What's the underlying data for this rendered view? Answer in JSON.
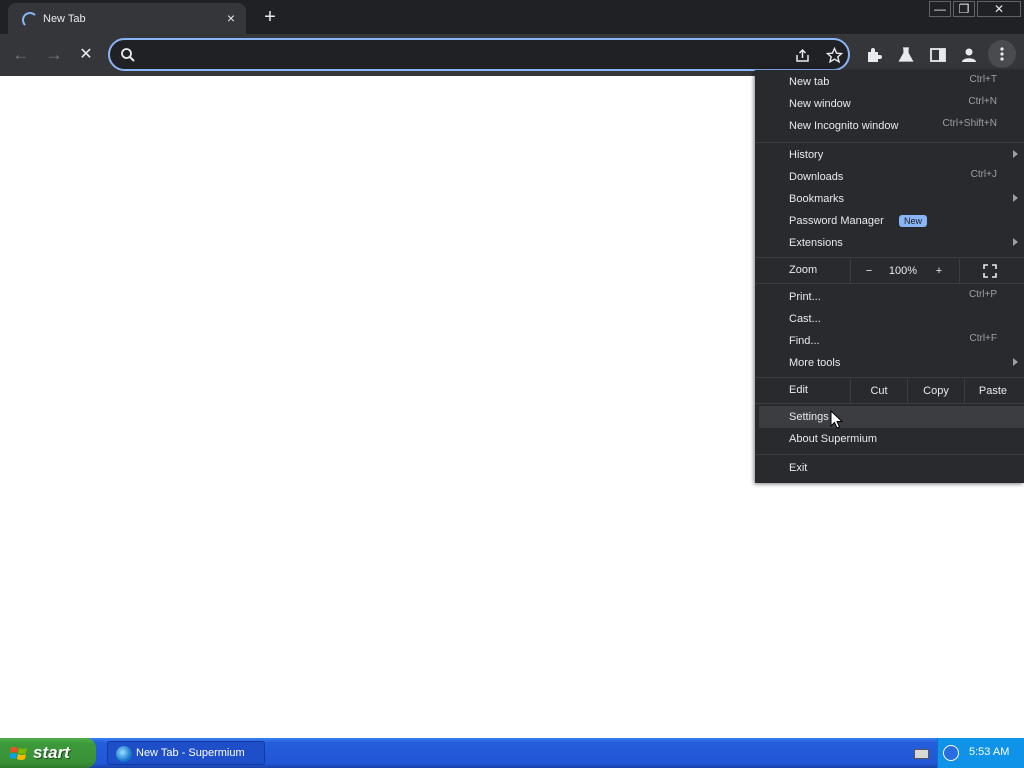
{
  "tab": {
    "title": "New Tab",
    "close": "×"
  },
  "newtab_glyph": "+",
  "window_controls": {
    "minimize": "—",
    "restore": "❐",
    "close": "✕"
  },
  "toolbar": {
    "back": "←",
    "forward": "→",
    "stop": "✕",
    "omnibox_value": ""
  },
  "menu": {
    "new_tab": {
      "label": "New tab",
      "shortcut": "Ctrl+T"
    },
    "new_window": {
      "label": "New window",
      "shortcut": "Ctrl+N"
    },
    "incognito": {
      "label": "New Incognito window",
      "shortcut": "Ctrl+Shift+N"
    },
    "history": {
      "label": "History"
    },
    "downloads": {
      "label": "Downloads",
      "shortcut": "Ctrl+J"
    },
    "bookmarks": {
      "label": "Bookmarks"
    },
    "password_manager": {
      "label": "Password Manager",
      "badge": "New"
    },
    "extensions": {
      "label": "Extensions"
    },
    "zoom": {
      "label": "Zoom",
      "minus": "−",
      "value": "100%",
      "plus": "+"
    },
    "print": {
      "label": "Print...",
      "shortcut": "Ctrl+P"
    },
    "cast": {
      "label": "Cast..."
    },
    "find": {
      "label": "Find...",
      "shortcut": "Ctrl+F"
    },
    "more_tools": {
      "label": "More tools"
    },
    "edit": {
      "label": "Edit",
      "cut": "Cut",
      "copy": "Copy",
      "paste": "Paste"
    },
    "settings": {
      "label": "Settings"
    },
    "about": {
      "label": "About Supermium"
    },
    "exit": {
      "label": "Exit"
    }
  },
  "taskbar": {
    "start_label": "start",
    "task_label": "New Tab - Supermium",
    "clock": "5:53 AM"
  },
  "colors": {
    "accent": "#8ab4f8",
    "menu_bg": "#292a2d",
    "toolbar_bg": "#35363a",
    "taskbar": "#245edb",
    "start": "#3c9a3a"
  }
}
